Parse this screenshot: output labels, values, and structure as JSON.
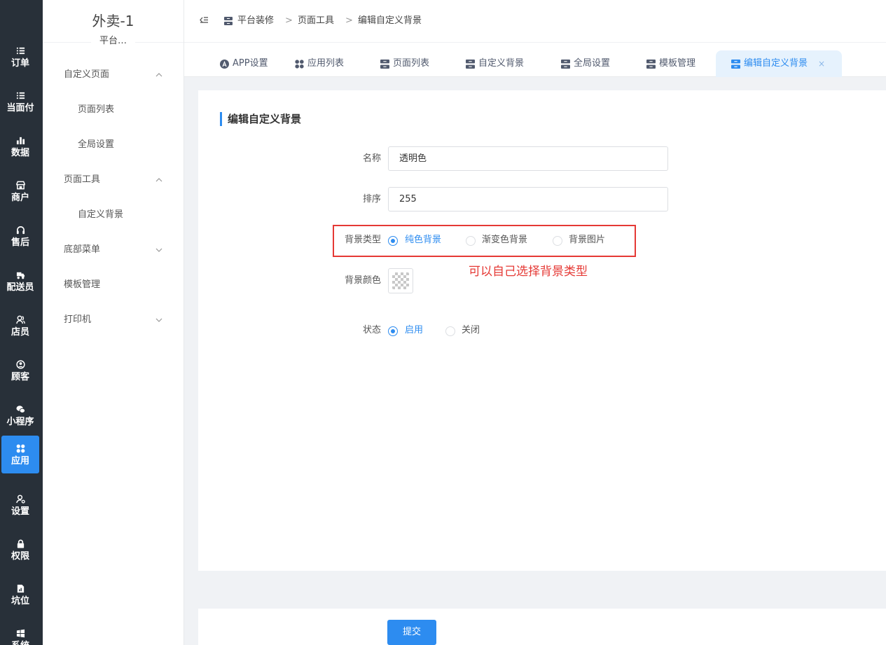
{
  "rail": {
    "items": [
      {
        "label": "订单",
        "icon": "list-icon"
      },
      {
        "label": "当面付",
        "icon": "list-icon"
      },
      {
        "label": "数据",
        "icon": "bar-chart-icon"
      },
      {
        "label": "商户",
        "icon": "store-icon"
      },
      {
        "label": "售后",
        "icon": "headset-icon"
      },
      {
        "label": "配送员",
        "icon": "delivery-icon"
      },
      {
        "label": "店员",
        "icon": "staff-icon"
      },
      {
        "label": "顾客",
        "icon": "customer-icon"
      },
      {
        "label": "小程序",
        "icon": "wechat-icon"
      },
      {
        "label": "应用",
        "icon": "apps-icon"
      },
      {
        "label": "设置",
        "icon": "user-settings-icon"
      },
      {
        "label": "权限",
        "icon": "lock-icon"
      },
      {
        "label": "坑位",
        "icon": "slot-icon"
      },
      {
        "label": "系统",
        "icon": "windows-icon"
      }
    ],
    "active_label": "应用",
    "active_color": "#2d8cf0",
    "background": "#283039"
  },
  "sidebar": {
    "brand": "外卖-1",
    "brand_sub": "平台…",
    "items": [
      {
        "label": "自定义页面",
        "type": "group",
        "expanded": true
      },
      {
        "label": "页面列表",
        "type": "child"
      },
      {
        "label": "全局设置",
        "type": "child"
      },
      {
        "label": "页面工具",
        "type": "group",
        "expanded": true
      },
      {
        "label": "自定义背景",
        "type": "child"
      },
      {
        "label": "底部菜单",
        "type": "group",
        "expanded": false
      },
      {
        "label": "模板管理",
        "type": "plain"
      },
      {
        "label": "打印机",
        "type": "group",
        "expanded": false
      }
    ]
  },
  "breadcrumb": {
    "items": [
      "平台装修",
      "页面工具",
      "编辑自定义背景"
    ],
    "separator": ">"
  },
  "tabs": {
    "items": [
      {
        "label": "APP设置",
        "icon": "app-store-icon"
      },
      {
        "label": "应用列表",
        "icon": "apps-icon"
      },
      {
        "label": "页面列表",
        "icon": "server-icon"
      },
      {
        "label": "自定义背景",
        "icon": "server-icon"
      },
      {
        "label": "全局设置",
        "icon": "server-icon"
      },
      {
        "label": "模板管理",
        "icon": "server-icon"
      },
      {
        "label": "编辑自定义背景",
        "icon": "server-icon",
        "active": true
      }
    ],
    "close_symbol": "×"
  },
  "form": {
    "title": "编辑自定义背景",
    "name_label": "名称",
    "name_value": "透明色",
    "sort_label": "排序",
    "sort_value": "255",
    "bg_type_label": "背景类型",
    "bg_type_options": [
      "纯色背景",
      "渐变色背景",
      "背景图片"
    ],
    "bg_type_selected": "纯色背景",
    "bg_color_label": "背景颜色",
    "status_label": "状态",
    "status_options": [
      "启用",
      "关闭"
    ],
    "status_selected": "启用",
    "annotation": "可以自己选择背景类型",
    "annotation_color": "#e53935",
    "submit_label": "提交"
  }
}
